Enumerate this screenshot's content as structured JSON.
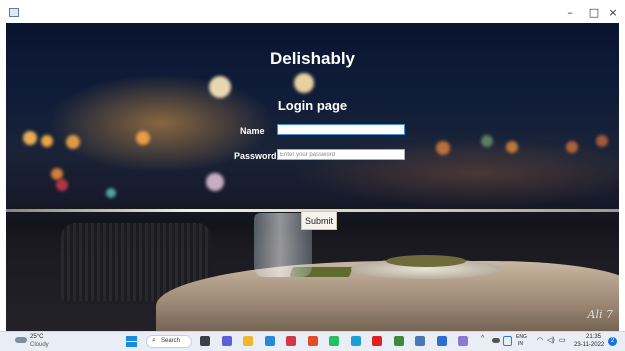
{
  "window": {
    "minimize_glyph": "–",
    "maximize_glyph": "□",
    "close_glyph": "×"
  },
  "app": {
    "title": "Delishably",
    "page_title": "Login page",
    "name_label": "Name",
    "name_value": "",
    "password_label": "Password",
    "password_placeholder": "Enter your password",
    "submit_label": "Submit",
    "background_signature": "Ali 7"
  },
  "taskbar": {
    "weather_temp": "25°C",
    "weather_desc": "Cloudy",
    "search_label": "Search",
    "search_icon_glyph": "⌕",
    "pinned_apps": [
      {
        "name": "task-view",
        "color": "#3a3f4a"
      },
      {
        "name": "chat",
        "color": "#5c5fd6"
      },
      {
        "name": "file-explorer",
        "color": "#f2b52a"
      },
      {
        "name": "notes",
        "color": "#2b88d8"
      },
      {
        "name": "media",
        "color": "#d23a4a"
      },
      {
        "name": "office",
        "color": "#e24a2a"
      },
      {
        "name": "whatsapp",
        "color": "#25c060"
      },
      {
        "name": "edge",
        "color": "#1c9fd8"
      },
      {
        "name": "youtube",
        "color": "#e02020"
      },
      {
        "name": "chrome",
        "color": "#3c8a3a"
      },
      {
        "name": "settings",
        "color": "#4a78b0"
      },
      {
        "name": "shield",
        "color": "#2d6fd0"
      },
      {
        "name": "photos",
        "color": "#8a7ad0"
      }
    ],
    "tray_arrow": "^",
    "lang_line1": "ENG",
    "lang_line2": "IN",
    "wifi_glyph": "◠",
    "volume_glyph": "◁)",
    "battery_glyph": "▭",
    "time": "21:35",
    "date": "23-11-2022",
    "notification_count": "2"
  }
}
